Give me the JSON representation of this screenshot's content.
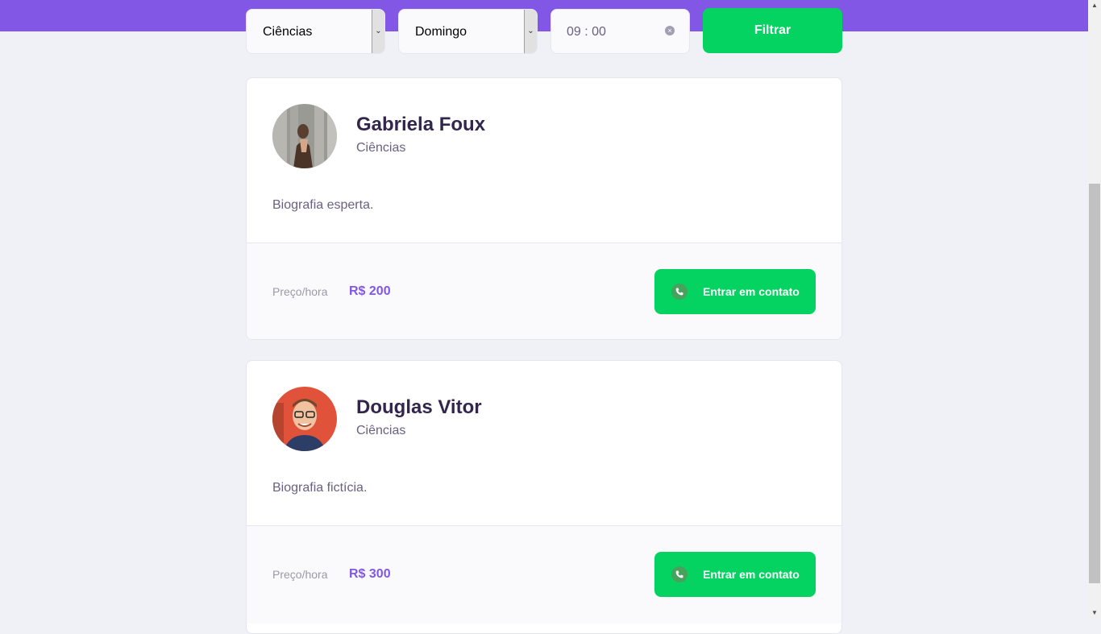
{
  "filters": {
    "subject": "Ciências",
    "week_day": "Domingo",
    "time": "09 : 00",
    "button": "Filtrar"
  },
  "teachers": [
    {
      "name": "Gabriela Foux",
      "subject": "Ciências",
      "bio": "Biografia esperta.",
      "price_label": "Preço/hora",
      "price": "R$ 200",
      "contact": "Entrar em contato"
    },
    {
      "name": "Douglas Vitor",
      "subject": "Ciências",
      "bio": "Biografia fictícia.",
      "price_label": "Preço/hora",
      "price": "R$ 300",
      "contact": "Entrar em contato"
    }
  ],
  "icons": {
    "select_arrow": "chevron-down-icon",
    "clear": "clear-icon",
    "contact": "whatsapp-icon"
  },
  "colors": {
    "primary": "#8257e5",
    "secondary": "#04d361",
    "title": "#32264d",
    "text": "#6a6180",
    "background": "#f0f0f7"
  }
}
